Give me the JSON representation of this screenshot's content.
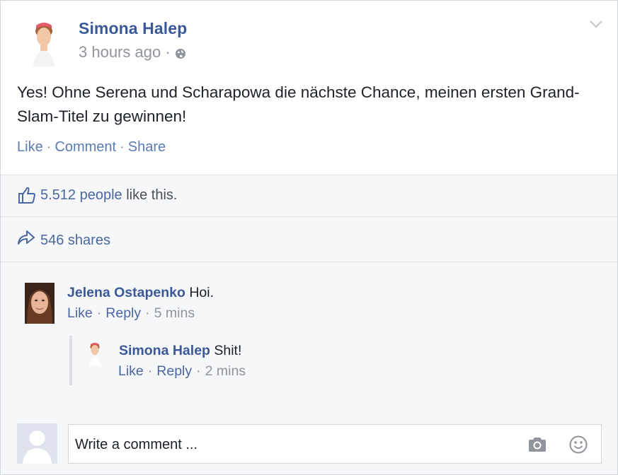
{
  "post": {
    "author": "Simona Halep",
    "time": "3 hours ago",
    "meta_sep": "·",
    "text": "Yes! Ohne Serena und Scharapowa die nächste Chance, meinen ersten Grand-Slam-Titel zu gewinnen!",
    "actions": {
      "like": "Like",
      "comment": "Comment",
      "share": "Share",
      "sep": "·"
    }
  },
  "likes": {
    "count": "5.512 people",
    "suffix": " like this."
  },
  "shares": {
    "label": "546 shares"
  },
  "comments": [
    {
      "author": "Jelena Ostapenko",
      "text": " Hoi.",
      "like": "Like",
      "reply": "Reply",
      "time": "5 mins",
      "sep": "·"
    },
    {
      "author": "Simona Halep",
      "text": " Shit!",
      "like": "Like",
      "reply": "Reply",
      "time": "2 mins",
      "sep": "·"
    }
  ],
  "composer": {
    "placeholder": "Write a comment ..."
  },
  "icons": {
    "globe": "globe-icon",
    "chevron": "chevron-down-icon",
    "thumb": "thumbs-up-icon",
    "share": "share-arrow-icon",
    "camera": "camera-icon",
    "emoji": "smiley-icon"
  },
  "colors": {
    "link": "#4b67a1",
    "name": "#3b5998",
    "muted": "#90949c",
    "panel": "#f6f7f9"
  }
}
